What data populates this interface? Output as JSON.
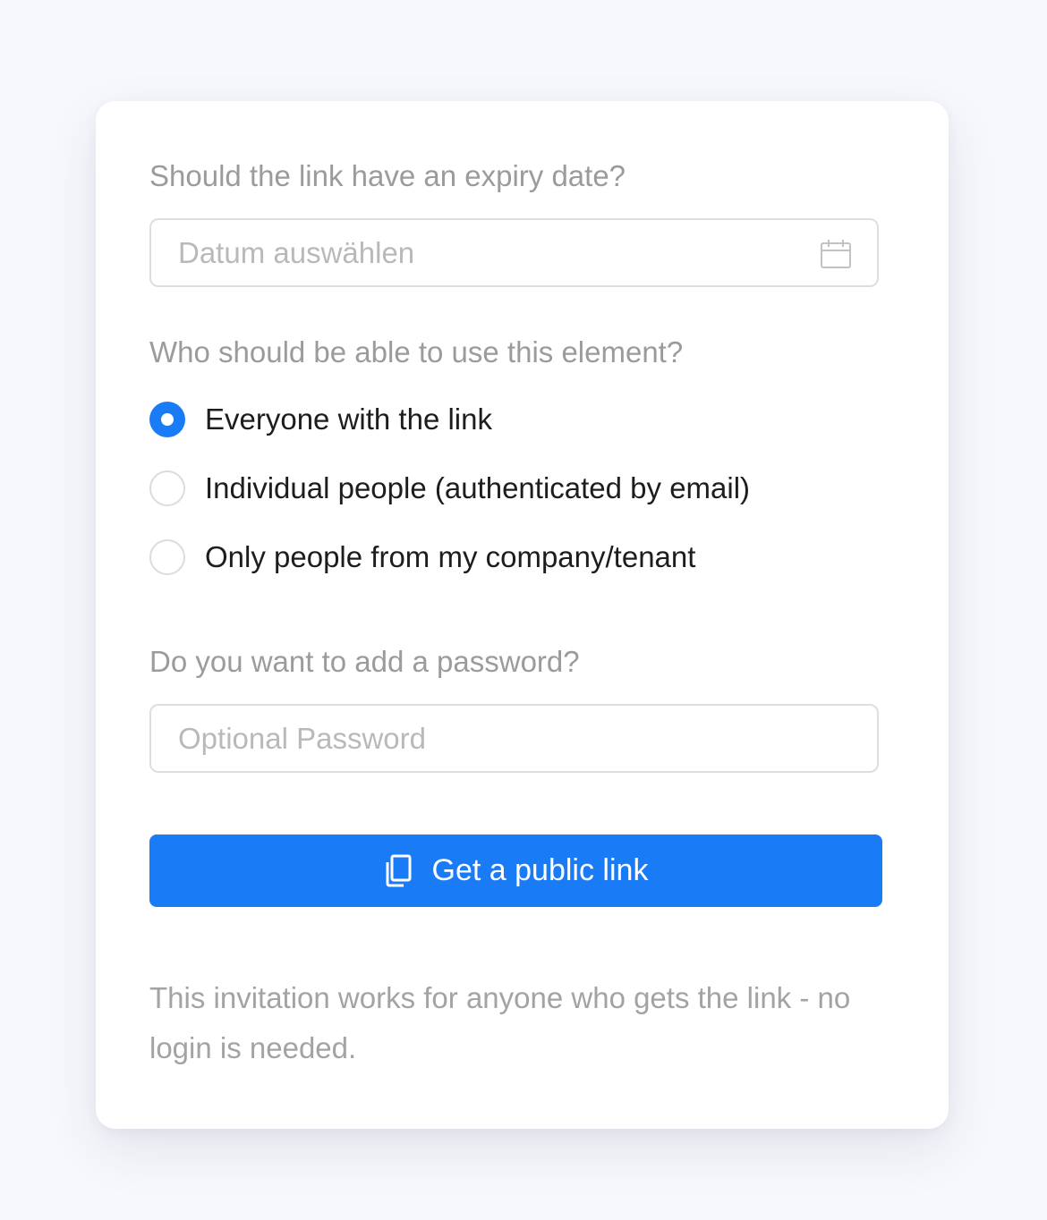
{
  "expiry": {
    "question": "Should the link have an expiry date?",
    "placeholder": "Datum auswählen",
    "icon": "calendar-icon"
  },
  "access": {
    "question": "Who should be able to use this element?",
    "options": [
      {
        "label": "Everyone with the link",
        "selected": true
      },
      {
        "label": "Individual people (authenticated by email)",
        "selected": false
      },
      {
        "label": "Only people from my company/tenant",
        "selected": false
      }
    ]
  },
  "password": {
    "question": "Do you want to add a password?",
    "placeholder": "Optional Password"
  },
  "cta": {
    "label": "Get a public link",
    "icon": "copy-icon"
  },
  "note": "This invitation works for anyone who gets the link - no login is needed.",
  "colors": {
    "accent": "#1a7bf6",
    "muted_text": "#9b9b9b",
    "body_text": "#1d1d1d",
    "border": "#dedede"
  }
}
